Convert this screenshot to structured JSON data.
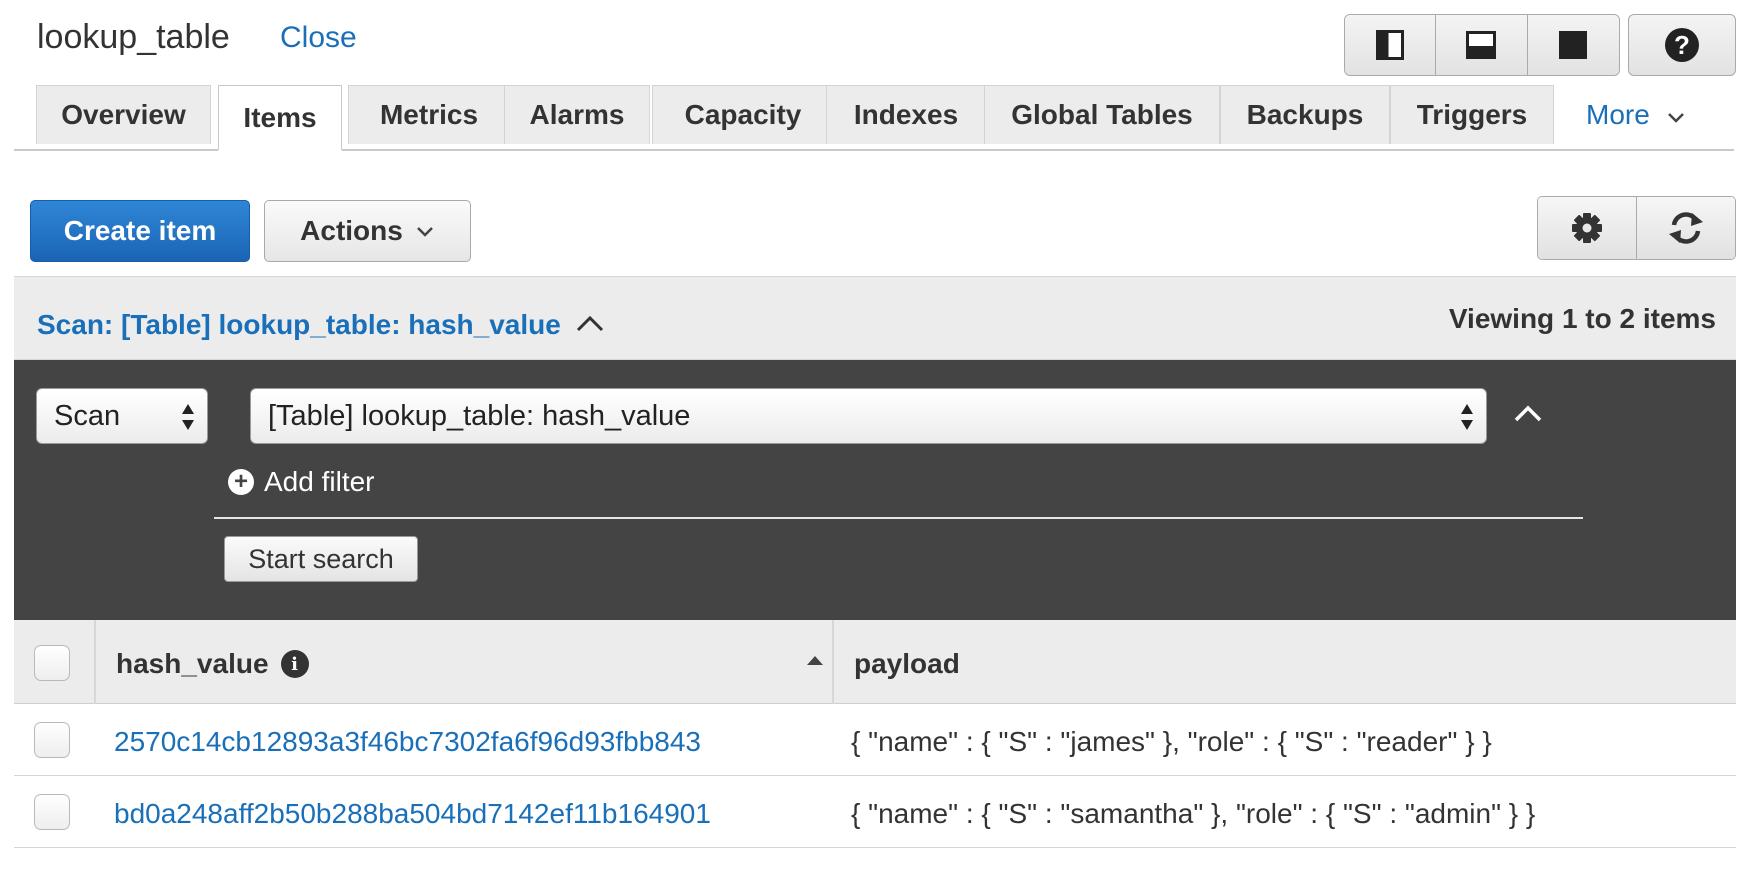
{
  "header": {
    "title": "lookup_table",
    "close_label": "Close",
    "view_icons": [
      "split-right-view-icon",
      "split-bottom-view-icon",
      "full-view-icon"
    ],
    "help_icon": "help-icon"
  },
  "tabs": {
    "items": [
      {
        "label": "Overview",
        "active": false
      },
      {
        "label": "Items",
        "active": true
      },
      {
        "label": "Metrics",
        "active": false
      },
      {
        "label": "Alarms",
        "active": false
      },
      {
        "label": "Capacity",
        "active": false
      },
      {
        "label": "Indexes",
        "active": false
      },
      {
        "label": "Global Tables",
        "active": false
      },
      {
        "label": "Backups",
        "active": false
      },
      {
        "label": "Triggers",
        "active": false
      }
    ],
    "more_label": "More"
  },
  "toolbar": {
    "create_label": "Create item",
    "actions_label": "Actions",
    "settings_icon": "gear-icon",
    "refresh_icon": "refresh-icon"
  },
  "scan": {
    "summary_label": "Scan: [Table] lookup_table: hash_value",
    "viewing_label": "Viewing 1 to 2 items",
    "mode_value": "Scan",
    "target_value": "[Table] lookup_table: hash_value",
    "add_filter_label": "Add filter",
    "start_label": "Start search"
  },
  "grid": {
    "columns": [
      "hash_value",
      "payload"
    ],
    "rows": [
      {
        "hash_value": "2570c14cb12893a3f46bc7302fa6f96d93fbb843",
        "payload": "{ \"name\" : { \"S\" : \"james\" }, \"role\" : { \"S\" : \"reader\" } }"
      },
      {
        "hash_value": "bd0a248aff2b50b288ba504bd7142ef11b164901",
        "payload": "{ \"name\" : { \"S\" : \"samantha\" }, \"role\" : { \"S\" : \"admin\" } }"
      }
    ]
  },
  "colors": {
    "link": "#1a6fb9",
    "primary_button": "#1b64b5",
    "dark_panel": "#444444",
    "header_bg": "#ececec"
  }
}
